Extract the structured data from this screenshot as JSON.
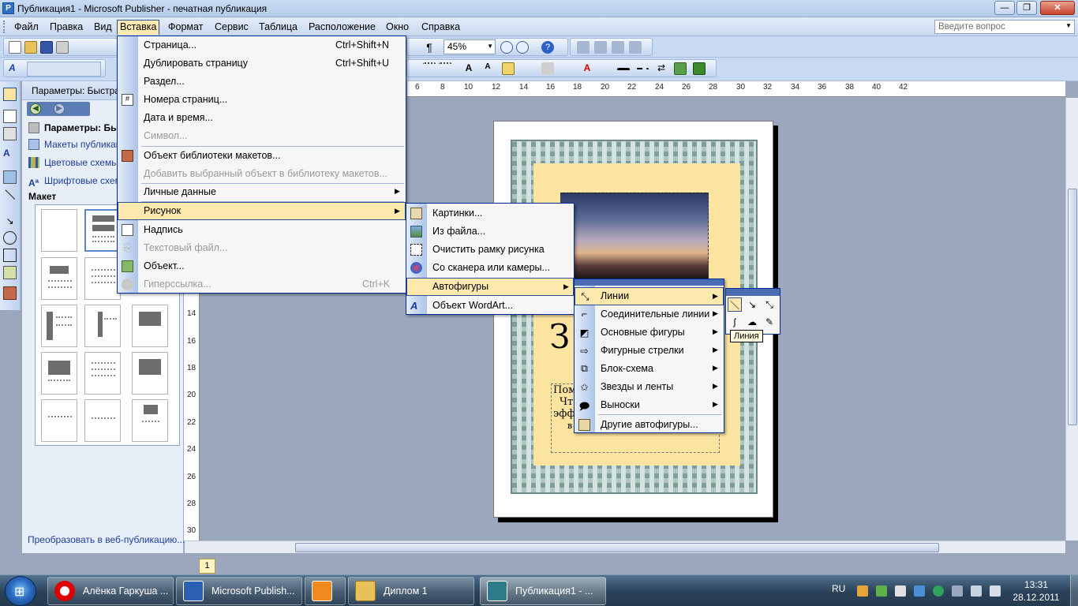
{
  "window": {
    "title": "Публикация1 - Microsoft Publisher - печатная публикация",
    "controls": [
      "—",
      "❐",
      "✕"
    ]
  },
  "menubar": {
    "items": [
      "Файл",
      "Правка",
      "Вид",
      "Вставка",
      "Формат",
      "Сервис",
      "Таблица",
      "Расположение",
      "Окно",
      "Справка"
    ],
    "active": "Вставка",
    "help_placeholder": "Введите вопрос"
  },
  "toolbar": {
    "zoom": "45%"
  },
  "insert_menu": {
    "items": [
      {
        "label": "Страница...",
        "shortcut": "Ctrl+Shift+N",
        "disabled": false
      },
      {
        "label": "Дублировать страницу",
        "shortcut": "Ctrl+Shift+U",
        "disabled": false
      },
      {
        "label": "Раздел...",
        "shortcut": "",
        "disabled": false
      },
      {
        "label": "Номера страниц...",
        "shortcut": "",
        "disabled": false
      },
      {
        "label": "Дата и время...",
        "shortcut": "",
        "disabled": false
      },
      {
        "label": "Символ...",
        "shortcut": "",
        "disabled": true
      },
      {
        "label": "Объект библиотеки макетов...",
        "shortcut": "",
        "disabled": false
      },
      {
        "label": "Добавить выбранный объект в библиотеку макетов...",
        "shortcut": "",
        "disabled": true
      },
      {
        "label": "Личные данные",
        "shortcut": "",
        "disabled": false,
        "submenu": true
      },
      {
        "label": "Рисунок",
        "shortcut": "",
        "disabled": false,
        "submenu": true,
        "highlighted": true
      },
      {
        "label": "Надпись",
        "shortcut": "",
        "disabled": false
      },
      {
        "label": "Текстовый файл...",
        "shortcut": "",
        "disabled": true
      },
      {
        "label": "Объект...",
        "shortcut": "",
        "disabled": false
      },
      {
        "label": "Гиперссылка...",
        "shortcut": "Ctrl+K",
        "disabled": true
      }
    ]
  },
  "picture_menu": {
    "items": [
      {
        "label": "Картинки...",
        "icon": "clipart-icon"
      },
      {
        "label": "Из файла...",
        "icon": "image-file-icon"
      },
      {
        "label": "Очистить рамку рисунка",
        "icon": "empty-frame-icon"
      },
      {
        "label": "Со сканера или камеры...",
        "icon": "scanner-icon"
      },
      {
        "label": "Автофигуры",
        "icon": "",
        "submenu": true,
        "highlighted": true
      },
      {
        "label": "Объект WordArt...",
        "icon": "wordart-icon"
      }
    ]
  },
  "autoshapes_menu": {
    "items": [
      {
        "label": "Линии",
        "icon": "lines-icon",
        "submenu": true,
        "highlighted": true
      },
      {
        "label": "Соединительные линии",
        "icon": "connectors-icon",
        "submenu": true
      },
      {
        "label": "Основные фигуры",
        "icon": "basic-shapes-icon",
        "submenu": true
      },
      {
        "label": "Фигурные стрелки",
        "icon": "block-arrows-icon",
        "submenu": true
      },
      {
        "label": "Блок-схема",
        "icon": "flowchart-icon",
        "submenu": true
      },
      {
        "label": "Звезды и ленты",
        "icon": "stars-icon",
        "submenu": true
      },
      {
        "label": "Выноски",
        "icon": "callouts-icon",
        "submenu": true
      },
      {
        "label": "Другие автофигуры...",
        "icon": "more-shapes-icon",
        "submenu": false
      }
    ]
  },
  "lines_palette": {
    "tooltip": "Линия",
    "buttons": [
      "＼",
      "↘",
      "⤡",
      "ʃ",
      "☁",
      "✎"
    ]
  },
  "taskpane": {
    "header": "Параметры: Быстра",
    "title": "Параметры: Бы",
    "links": [
      "Макеты публикац",
      "Цветовые схемы",
      "Шрифтовые схем"
    ],
    "section": "Макет",
    "footer": "Преобразовать в веб-публикацию..."
  },
  "rulers": {
    "h_ticks": [
      "6",
      "8",
      "10",
      "12",
      "14",
      "16",
      "18",
      "20",
      "22",
      "24",
      "26",
      "28",
      "30",
      "32",
      "34",
      "36",
      "38",
      "40",
      "42"
    ],
    "v_ticks": [
      "14",
      "16",
      "18",
      "20",
      "22",
      "24",
      "26",
      "28",
      "30"
    ]
  },
  "page": {
    "big_letter": "З",
    "text_lines": [
      "Пом",
      "Что",
      "эфф",
      "в"
    ],
    "page_number": "1"
  },
  "taskbar": {
    "items": [
      "Алёнка Гаркуша ...",
      "Microsoft Publish...",
      "",
      "Диплом 1",
      "Публикация1 - ..."
    ],
    "lang": "RU",
    "time": "13:31",
    "date": "28.12.2011"
  },
  "colors": {
    "menu_highlight": "#fde9ae",
    "menu_border": "#002d96",
    "xp_blue": "#c9d9f1"
  }
}
